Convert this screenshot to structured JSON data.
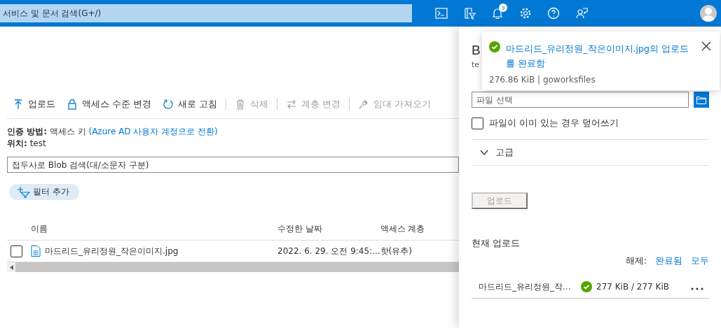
{
  "topbar": {
    "search": {
      "placeholder": "서비스 및 문서 검색(G+/)"
    },
    "notification_count": "3"
  },
  "toolbar": [
    {
      "label": "업로드",
      "disabled": false
    },
    {
      "label": "액세스 수준 변경",
      "disabled": false
    },
    {
      "label": "새로 고침",
      "disabled": false
    },
    {
      "label": "삭제",
      "disabled": true
    },
    {
      "label": "계층 변경",
      "disabled": true
    },
    {
      "label": "임대 가져오기",
      "disabled": true
    }
  ],
  "info": {
    "auth_label": "인증 방법:",
    "auth_value": "액세스 키",
    "auth_link": "(Azure AD 사용자 계정으로 전환)",
    "location_label": "위치:",
    "location_value": "test"
  },
  "blob_search": {
    "placeholder": "접두사로 Blob 검색(대/소문자 구분)"
  },
  "filter_button": "필터 추가",
  "table": {
    "columns": [
      "이름",
      "수정한 날짜",
      "액세스 계층"
    ],
    "rows": [
      {
        "checked": false,
        "name": "마드리드_유리정원_작은이미지.jpg",
        "modified": "2022. 6. 29. 오전 9:45:...",
        "tier": "핫(유추)"
      }
    ]
  },
  "panel": {
    "title": "B",
    "subtitle": "te",
    "file_field": {
      "placeholder": "파일 선택"
    },
    "overwrite": {
      "label": "파일이 이미 있는 경우 덮어쓰기",
      "checked": false
    },
    "advanced": {
      "label": "고급",
      "expanded": false
    },
    "upload_button": {
      "label": "업로드",
      "disabled": true
    },
    "current_uploads": "현재 업로드",
    "clear_label": "해제:",
    "clear_links": [
      "완료됨",
      "모두"
    ],
    "uploads": [
      {
        "name": "마드리드_유리정원_작...",
        "progress": "277 KiB / 277 KiB",
        "complete": true
      }
    ]
  },
  "toast": {
    "title": "마드리드_유리정원_작은이미지.jpg의 업로드를 완료함",
    "detail": "276.86 KiB | goworksfiles"
  }
}
